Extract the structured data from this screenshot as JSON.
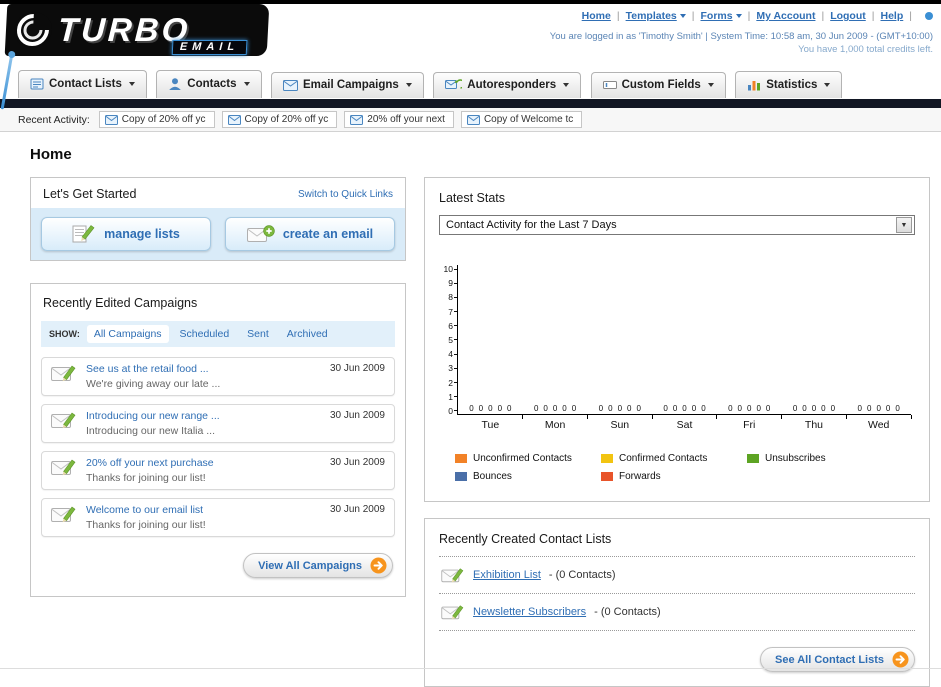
{
  "colors": {
    "link_blue": "#2f6eb4",
    "accent_orange": "#f7941d",
    "nav_dark_bar": "#121724",
    "light_blue_bg": "#d9ebf8"
  },
  "header": {
    "logo_text": "TURBO",
    "logo_sub": "EMAIL",
    "links": [
      {
        "label": "Home",
        "dropdown": false
      },
      {
        "label": "Templates",
        "dropdown": true
      },
      {
        "label": "Forms",
        "dropdown": true
      },
      {
        "label": "My Account",
        "dropdown": false
      },
      {
        "label": "Logout",
        "dropdown": false
      },
      {
        "label": "Help",
        "dropdown": false
      }
    ],
    "login_info": "You are logged in as 'Timothy Smith' | System Time: 10:58 am, 30 Jun 2009 - (GMT+10:00)",
    "credits": "You have 1,000 total credits left."
  },
  "main_nav": {
    "items": [
      {
        "label": "Contact Lists"
      },
      {
        "label": "Contacts"
      },
      {
        "label": "Email Campaigns"
      },
      {
        "label": "Autoresponders"
      },
      {
        "label": "Custom Fields"
      },
      {
        "label": "Statistics"
      }
    ]
  },
  "recent_activity": {
    "label": "Recent Activity:",
    "items": [
      "Copy of 20% off yc",
      "Copy of 20% off yc",
      "20% off your next",
      "Copy of Welcome tc"
    ]
  },
  "page_title": "Home",
  "get_started": {
    "title": "Let's Get Started",
    "switch_link": "Switch to Quick Links",
    "manage_lists_label": "manage lists",
    "create_email_label": "create an email"
  },
  "campaigns": {
    "title": "Recently Edited Campaigns",
    "show_label": "SHOW:",
    "tabs": [
      "All Campaigns",
      "Scheduled",
      "Sent",
      "Archived"
    ],
    "active_tab": "All Campaigns",
    "items": [
      {
        "title": "See us at the retail food ...",
        "subtitle": "We're giving away our late ...",
        "date": "30 Jun 2009"
      },
      {
        "title": "Introducing our new range ...",
        "subtitle": "Introducing our new Italia ...",
        "date": "30 Jun 2009"
      },
      {
        "title": "20% off your next purchase",
        "subtitle": "Thanks for joining our list!",
        "date": "30 Jun 2009"
      },
      {
        "title": "Welcome to our email list",
        "subtitle": "Thanks for joining our list!",
        "date": "30 Jun 2009"
      }
    ],
    "view_all_label": "View All Campaigns"
  },
  "stats": {
    "title": "Latest Stats",
    "period_selector": "Contact Activity for the Last 7 Days",
    "chart_data": {
      "type": "bar",
      "categories": [
        "Tue",
        "Mon",
        "Sun",
        "Sat",
        "Fri",
        "Thu",
        "Wed"
      ],
      "series": [
        {
          "name": "Unconfirmed Contacts",
          "color": "#f28227",
          "values": [
            0,
            0,
            0,
            0,
            0,
            0,
            0
          ]
        },
        {
          "name": "Confirmed Contacts",
          "color": "#f2c411",
          "values": [
            0,
            0,
            0,
            0,
            0,
            0,
            0
          ]
        },
        {
          "name": "Unsubscribes",
          "color": "#5da423",
          "values": [
            0,
            0,
            0,
            0,
            0,
            0,
            0
          ]
        },
        {
          "name": "Bounces",
          "color": "#4a6fa8",
          "values": [
            0,
            0,
            0,
            0,
            0,
            0,
            0
          ]
        },
        {
          "name": "Forwards",
          "color": "#e8542a",
          "values": [
            0,
            0,
            0,
            0,
            0,
            0,
            0
          ]
        }
      ],
      "ylim": [
        0,
        10
      ],
      "ytick_step": 1,
      "grid": false,
      "legend_position": "bottom"
    }
  },
  "contact_lists": {
    "title": "Recently Created Contact Lists",
    "items": [
      {
        "name": "Exhibition List",
        "meta": "- (0 Contacts)"
      },
      {
        "name": "Newsletter Subscribers",
        "meta": "- (0 Contacts)"
      }
    ],
    "see_all_label": "See All Contact Lists"
  }
}
